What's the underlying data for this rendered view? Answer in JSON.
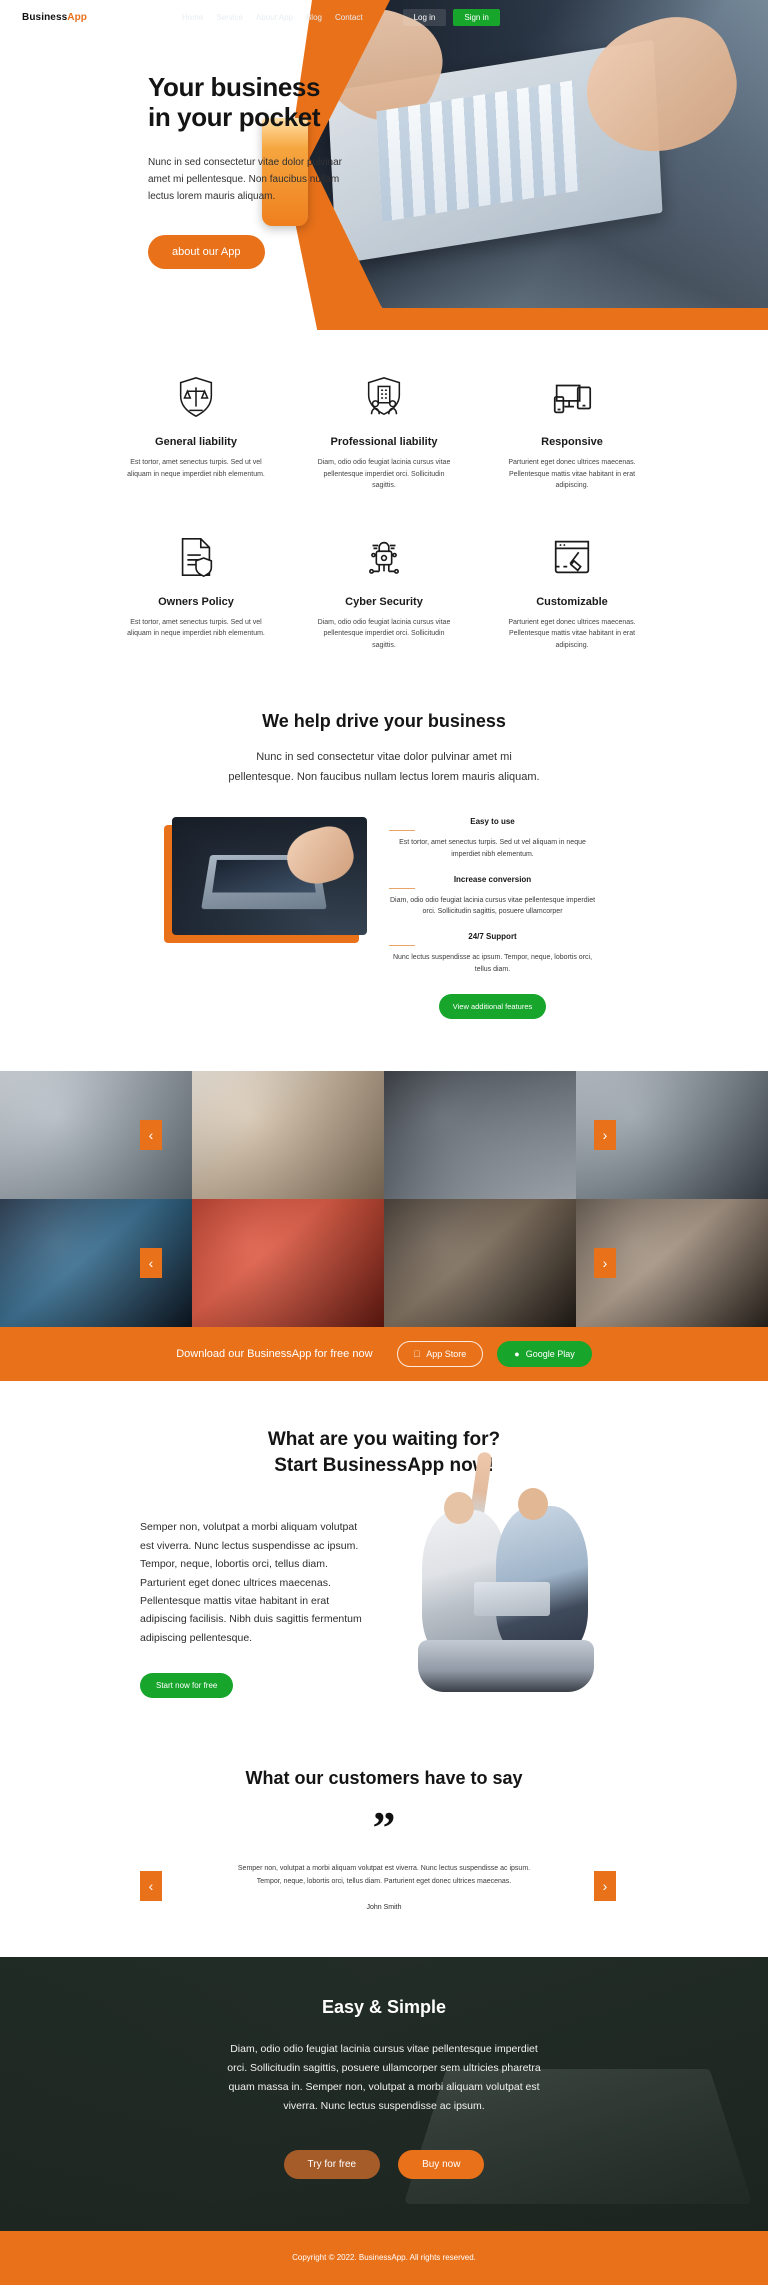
{
  "brand": {
    "first": "Business",
    "second": "App"
  },
  "nav": {
    "links": [
      {
        "label": "Home"
      },
      {
        "label": "Service"
      },
      {
        "label": "About App"
      },
      {
        "label": "Blog"
      },
      {
        "label": "Contact"
      }
    ],
    "login_label": "Log in",
    "signin_label": "Sign in"
  },
  "hero": {
    "title_line1": "Your business",
    "title_line2": "in your pocket",
    "paragraph": "Nunc in sed consectetur vitae dolor pulvinar amet mi pellentesque. Non faucibus nullam lectus lorem mauris aliquam.",
    "cta_label": "about our App"
  },
  "features": [
    {
      "icon": "scales-shield-icon",
      "title": "General liability",
      "desc": "Est tortor, amet senectus turpis. Sed ut vel aliquam in neque imperdiet nibh elementum."
    },
    {
      "icon": "building-people-shield-icon",
      "title": "Professional liability",
      "desc": "Diam, odio odio feugiat lacinia cursus vitae pellentesque imperdiet orci. Sollicitudin sagittis."
    },
    {
      "icon": "devices-icon",
      "title": "Responsive",
      "desc": "Parturient eget donec ultrices maecenas. Pellentesque mattis vitae habitant in erat adipiscing."
    },
    {
      "icon": "document-shield-icon",
      "title": "Owners Policy",
      "desc": "Est tortor, amet senectus turpis. Sed ut vel aliquam in neque imperdiet nibh elementum."
    },
    {
      "icon": "lock-circuit-icon",
      "title": "Cyber Security",
      "desc": "Diam, odio odio feugiat lacinia cursus vitae pellentesque imperdiet orci. Sollicitudin sagittis."
    },
    {
      "icon": "browser-brush-icon",
      "title": "Customizable",
      "desc": "Parturient eget donec ultrices maecenas. Pellentesque mattis vitae habitant in erat adipiscing."
    }
  ],
  "drive": {
    "heading": "We help drive your business",
    "paragraph": "Nunc in sed consectetur vitae dolor pulvinar amet mi pellentesque. Non faucibus nullam lectus lorem mauris aliquam.",
    "image_alt": "person-pointing-at-laptop-photo",
    "items": [
      {
        "title": "Easy to use",
        "desc": "Est tortor, amet senectus turpis. Sed ut vel aliquam in neque imperdiet nibh elementum."
      },
      {
        "title": "Increase conversion",
        "desc": "Diam, odio odio feugiat lacinia cursus vitae pellentesque imperdiet orci. Sollicitudin sagittis, posuere ullamcorper"
      },
      {
        "title": "24/7 Support",
        "desc": "Nunc lectus suspendisse ac ipsum. Tempor, neque, lobortis orci, tellus diam."
      }
    ],
    "button_label": "View additional features"
  },
  "gallery": {
    "prev_label": "‹",
    "next_label": "›",
    "row1": [
      {
        "alt": "laptop-desk-photo"
      },
      {
        "alt": "coffee-notebook-photo"
      },
      {
        "alt": "people-meeting-laptop-photo"
      },
      {
        "alt": "hands-tablet-photo"
      }
    ],
    "row2": [
      {
        "alt": "stock-chart-screen-photo"
      },
      {
        "alt": "app-store-icon-phone-photo"
      },
      {
        "alt": "person-holding-phone-photo"
      },
      {
        "alt": "office-monitors-photo"
      }
    ]
  },
  "download": {
    "text": "Download our BusinessApp for free now",
    "appstore_label": "App Store",
    "appstore_icon": "apple-icon",
    "googleplay_label": "Google Play",
    "googleplay_icon": "android-icon"
  },
  "waiting": {
    "heading_line1": "What are you waiting for?",
    "heading_line2": "Start BusinessApp now!",
    "paragraph": "Semper non, volutpat a morbi aliquam volutpat est viverra. Nunc lectus suspendisse ac ipsum. Tempor, neque, lobortis orci, tellus diam. Parturient eget donec ultrices maecenas. Pellentesque mattis vitae habitant in erat adipiscing facilisis. Nibh duis sagittis fermentum adipiscing pellentesque.",
    "button_label": "Start now for free",
    "image_alt": "couple-celebrating-with-laptop-photo"
  },
  "testimonial": {
    "heading": "What our customers have to say",
    "quote_mark": "”",
    "text": "Semper non, volutpat a morbi aliquam volutpat est viverra. Nunc lectus suspendisse ac ipsum. Tempor, neque, lobortis orci, tellus diam. Parturient eget donec ultrices maecenas.",
    "author": "John Smith",
    "prev_label": "‹",
    "next_label": "›"
  },
  "easy": {
    "heading": "Easy & Simple",
    "paragraph": "Diam, odio odio feugiat lacinia cursus vitae pellentesque imperdiet orci. Sollicitudin sagittis, posuere ullamcorper sem ultricies pharetra quam massa in. Semper non, volutpat a morbi aliquam volutpat est viverra. Nunc lectus suspendisse ac ipsum.",
    "try_label": "Try for free",
    "buy_label": "Buy now"
  },
  "footer": {
    "copyright": "Copyright © 2022. BusinessApp. All rights reserved."
  },
  "colors": {
    "orange": "#e8711a",
    "green": "#17a52c",
    "dark": "#1f2923",
    "text": "#1b1b1b"
  }
}
